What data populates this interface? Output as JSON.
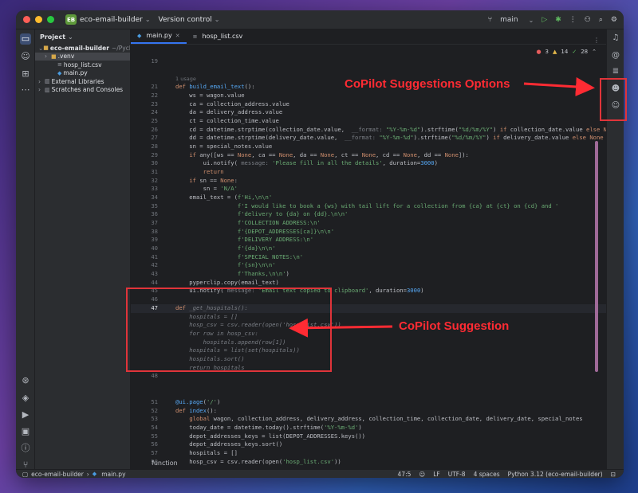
{
  "titlebar": {
    "project_badge": "EB",
    "project_name": "eco-email-builder",
    "vcs_label": "Version control",
    "branch": "main"
  },
  "project_panel": {
    "header": "Project",
    "items": [
      {
        "label": "eco-email-builder",
        "suffix": "~/Pycharm",
        "type": "folder",
        "indent": 0,
        "arrow": "⌄"
      },
      {
        "label": ".venv",
        "suffix": "",
        "type": "folder",
        "indent": 1,
        "arrow": "›",
        "selected": true
      },
      {
        "label": "hosp_list.csv",
        "suffix": "",
        "type": "csv",
        "indent": 2,
        "arrow": ""
      },
      {
        "label": "main.py",
        "suffix": "",
        "type": "py",
        "indent": 2,
        "arrow": ""
      },
      {
        "label": "External Libraries",
        "suffix": "",
        "type": "lib",
        "indent": 0,
        "arrow": "›"
      },
      {
        "label": "Scratches and Consoles",
        "suffix": "",
        "type": "lib",
        "indent": 0,
        "arrow": "›"
      }
    ]
  },
  "tabs": [
    {
      "label": "main.py",
      "active": true
    },
    {
      "label": "hosp_list.csv",
      "active": false
    }
  ],
  "inspections": {
    "errors": "3",
    "warnings": "14",
    "ok": "28"
  },
  "usage_hint": "1 usage",
  "code_context": "function",
  "statusbar": {
    "project": "eco-email-builder",
    "file": "main.py",
    "position": "47:5",
    "line_sep": "LF",
    "encoding": "UTF-8",
    "indent": "4 spaces",
    "interpreter": "Python 3.12 (eco-email-builder)"
  },
  "annotations": {
    "options_label": "CoPilot Suggestions Options",
    "suggestion_label": "CoPilot Suggestion"
  }
}
